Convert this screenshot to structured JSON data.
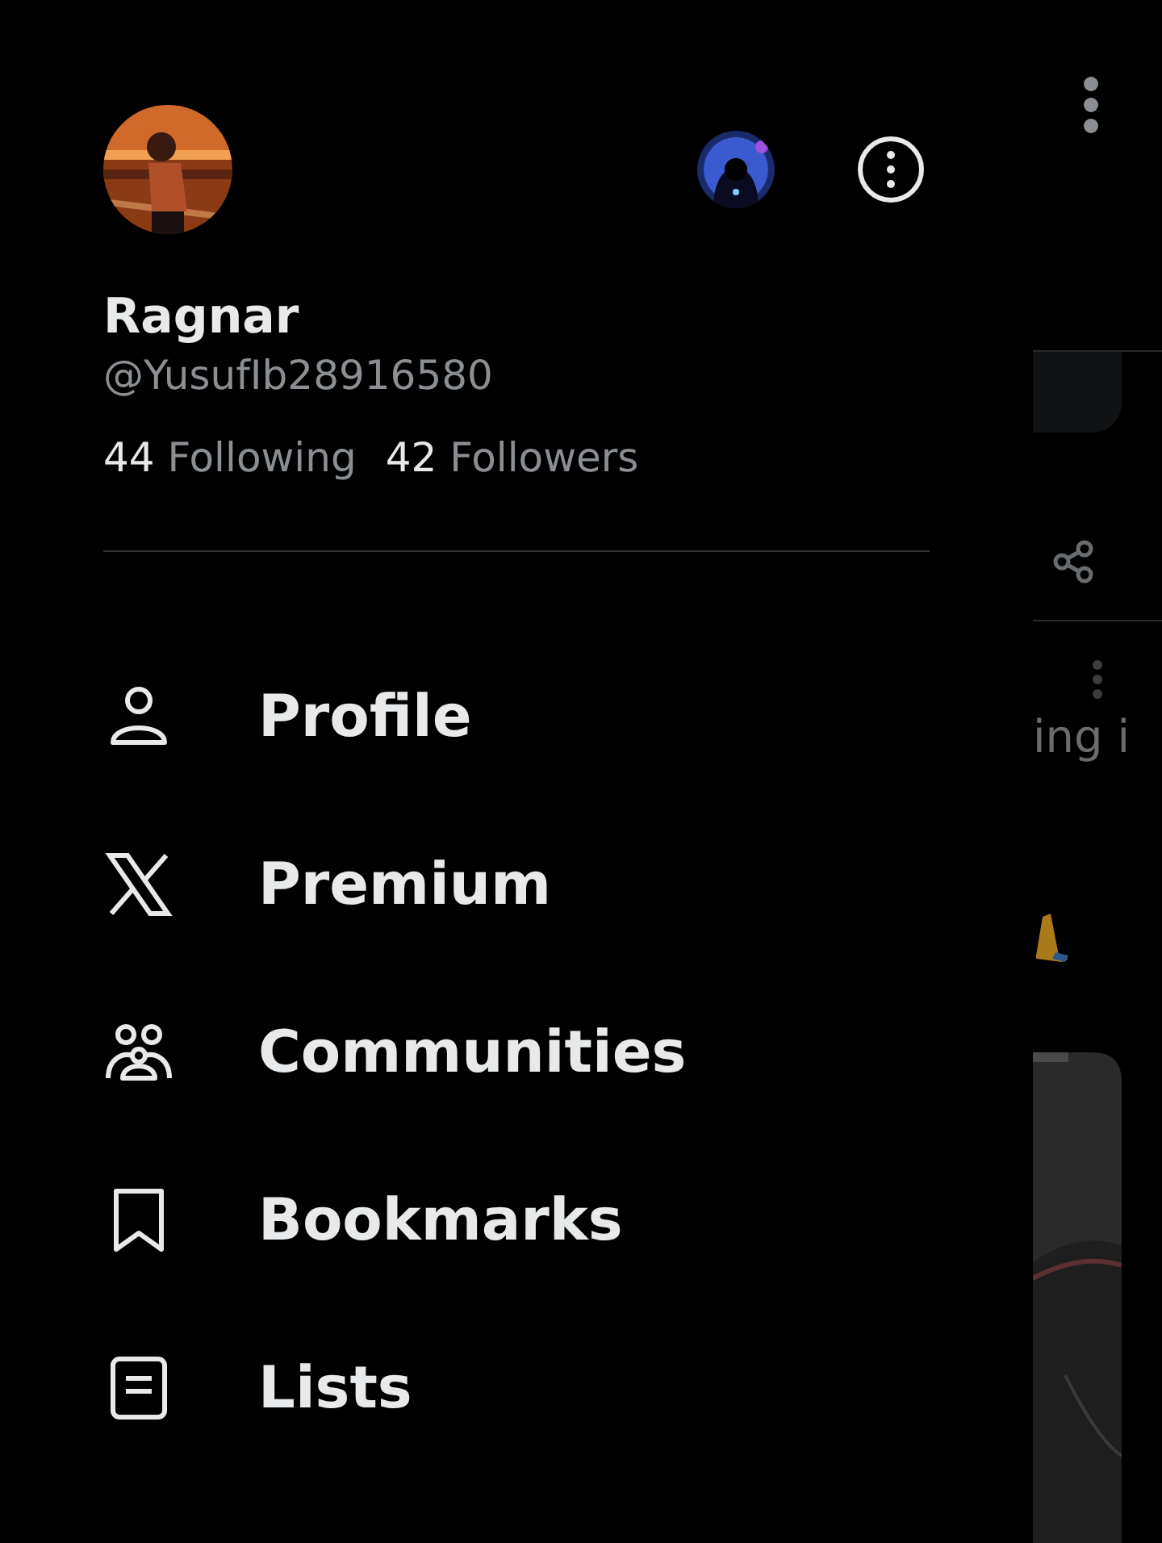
{
  "profile": {
    "name": "Ragnar",
    "handle": "@YusufIb28916580",
    "stats": [
      {
        "count": "44",
        "label": "Following"
      },
      {
        "count": "42",
        "label": "Followers"
      }
    ]
  },
  "menu": [
    {
      "label": "Profile",
      "kind": "person"
    },
    {
      "label": "Premium",
      "kind": "x"
    },
    {
      "label": "Communities",
      "kind": "people"
    },
    {
      "label": "Bookmarks",
      "kind": "bookmark"
    },
    {
      "label": "Lists",
      "kind": "list"
    }
  ],
  "background_feed": {
    "text": "ing i"
  }
}
